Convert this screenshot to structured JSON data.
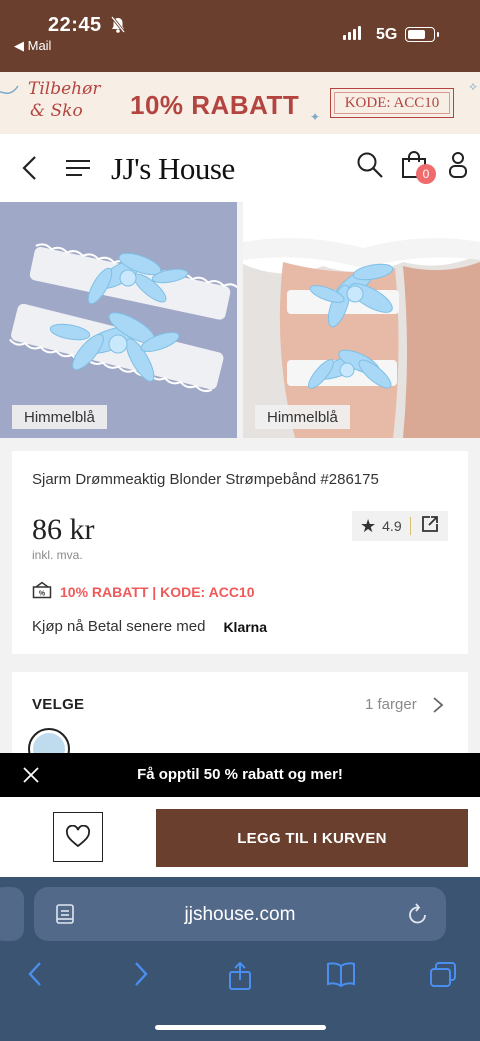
{
  "status_bar": {
    "time": "22:45",
    "back_app": "◀ Mail",
    "network": "5G"
  },
  "promo_banner": {
    "script_line1": "Tilbehør",
    "script_line2": "& Sko",
    "headline": "10% RABATT",
    "code": "KODE: ACC10"
  },
  "header": {
    "logo": "JJ's House",
    "cart_count": "0"
  },
  "gallery": {
    "images": [
      {
        "label": "Himmelblå",
        "icon": "garter-flat-image"
      },
      {
        "label": "Himmelblå",
        "icon": "garter-on-leg-image"
      }
    ]
  },
  "product": {
    "title": "Sjarm Drømmeaktig Blonder Strømpebånd #286175",
    "price": "86 kr",
    "tax_note": "inkl. mva.",
    "rating": "4.9",
    "promo": "10% RABATT | KODE: ACC10",
    "klarna_text": "Kjøp nå Betal senere med",
    "klarna_brand": "Klarna"
  },
  "options": {
    "label": "VELGE",
    "color_count": "1 farger",
    "selected_color": "#bfdcef"
  },
  "notice_strip": {
    "text": "Få opptil 50 % rabatt og mer!"
  },
  "actions": {
    "add_to_cart": "LEGG TIL I KURVEN"
  },
  "browser": {
    "url": "jjshouse.com"
  },
  "colors": {
    "brand_brown": "#6a3f2e",
    "promo_red": "#ee5a5a",
    "banner_red": "#b3443f",
    "browser_blue": "#3a5472",
    "toolbar_icon_blue": "#4a8ff0"
  }
}
